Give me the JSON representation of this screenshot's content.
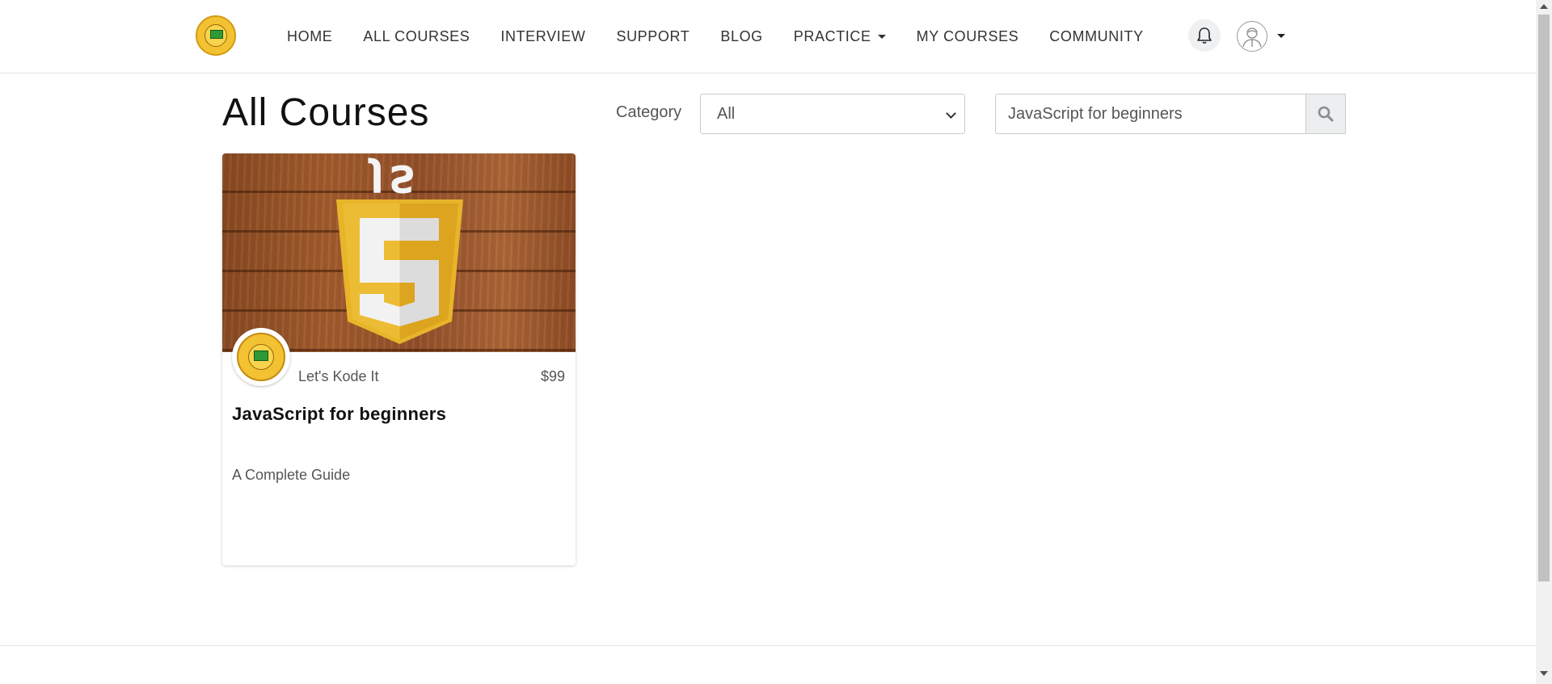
{
  "nav": {
    "items": [
      {
        "label": "HOME"
      },
      {
        "label": "ALL COURSES"
      },
      {
        "label": "INTERVIEW"
      },
      {
        "label": "SUPPORT"
      },
      {
        "label": "BLOG"
      },
      {
        "label": "PRACTICE"
      },
      {
        "label": "MY COURSES"
      },
      {
        "label": "COMMUNITY"
      }
    ]
  },
  "page": {
    "title": "All Courses"
  },
  "filters": {
    "category_label": "Category",
    "category_value": "All",
    "search_value": "JavaScript for beginners"
  },
  "course_card": {
    "image_badge_text": "JS",
    "image_shield_numeral": "5",
    "instructor": "Let's Kode It",
    "price": "$99",
    "title": "JavaScript for beginners",
    "subtitle": "A Complete Guide"
  },
  "icons": {
    "logo": "lets-kode-it-logo",
    "notification": "bell-icon",
    "profile": "user-avatar-icon",
    "search": "search-icon",
    "dropdown": "caret-down-icon"
  },
  "colors": {
    "js_shield": "#e8b52a",
    "wood": "#9b5529",
    "logo_gold": "#f2c233"
  }
}
